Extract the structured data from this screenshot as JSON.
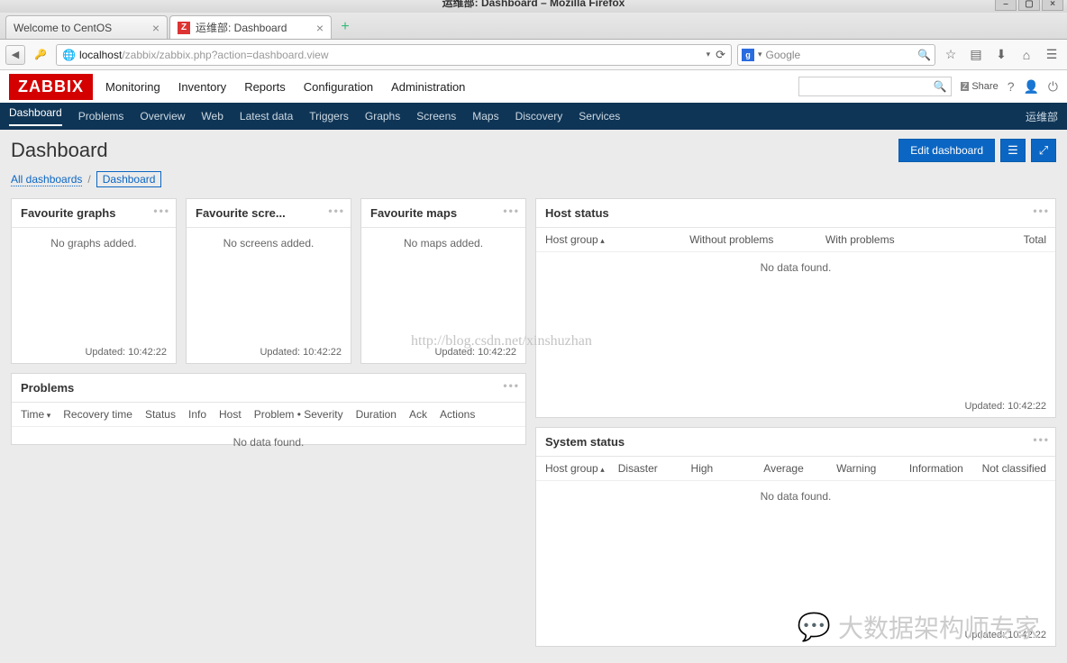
{
  "window": {
    "title": "运维部: Dashboard – Mozilla Firefox",
    "buttons": {
      "min": "–",
      "max": "▢",
      "close": "×"
    }
  },
  "tabs": [
    {
      "label": "Welcome to CentOS",
      "icon": ""
    },
    {
      "label": "运维部: Dashboard",
      "icon": "Z"
    }
  ],
  "tab_add": "+",
  "url": {
    "host": "localhost",
    "path": "/zabbix/zabbix.php?action=dashboard.view",
    "dropdown": "▾",
    "reload": "⟳"
  },
  "search_placeholder": "Google",
  "toolbar_icons": {
    "star": "☆",
    "clip": "▤",
    "down": "⬇",
    "home": "⌂",
    "menu": "☰"
  },
  "zabbix": {
    "logo": "ZABBIX",
    "nav": [
      "Monitoring",
      "Inventory",
      "Reports",
      "Configuration",
      "Administration"
    ],
    "share": "Share",
    "help": "?",
    "user": "👤",
    "power": "⏻",
    "subnav": [
      "Dashboard",
      "Problems",
      "Overview",
      "Web",
      "Latest data",
      "Triggers",
      "Graphs",
      "Screens",
      "Maps",
      "Discovery",
      "Services"
    ],
    "subnav_right": "运维部"
  },
  "page": {
    "title": "Dashboard",
    "edit": "Edit dashboard",
    "breadcrumb": {
      "all": "All dashboards",
      "sep": "/",
      "current": "Dashboard"
    }
  },
  "widgets": {
    "fav_graphs": {
      "title": "Favourite graphs",
      "empty": "No graphs added.",
      "updated": "Updated: 10:42:22"
    },
    "fav_screens": {
      "title": "Favourite scre...",
      "empty": "No screens added.",
      "updated": "Updated: 10:42:22"
    },
    "fav_maps": {
      "title": "Favourite maps",
      "empty": "No maps added.",
      "updated": "Updated: 10:42:22"
    },
    "problems": {
      "title": "Problems",
      "cols": [
        "Time",
        "Recovery time",
        "Status",
        "Info",
        "Host",
        "Problem • Severity",
        "Duration",
        "Ack",
        "Actions"
      ],
      "nodata": "No data found."
    },
    "host_status": {
      "title": "Host status",
      "cols": [
        "Host group",
        "Without problems",
        "With problems",
        "Total"
      ],
      "nodata": "No data found.",
      "updated": "Updated: 10:42:22"
    },
    "system_status": {
      "title": "System status",
      "cols": [
        "Host group",
        "Disaster",
        "High",
        "Average",
        "Warning",
        "Information",
        "Not classified"
      ],
      "nodata": "No data found.",
      "updated": "Updated: 10:42:22"
    }
  },
  "watermark_url": "http://blog.csdn.net/xinshuzhan",
  "watermark_text": "大数据架构师专家"
}
